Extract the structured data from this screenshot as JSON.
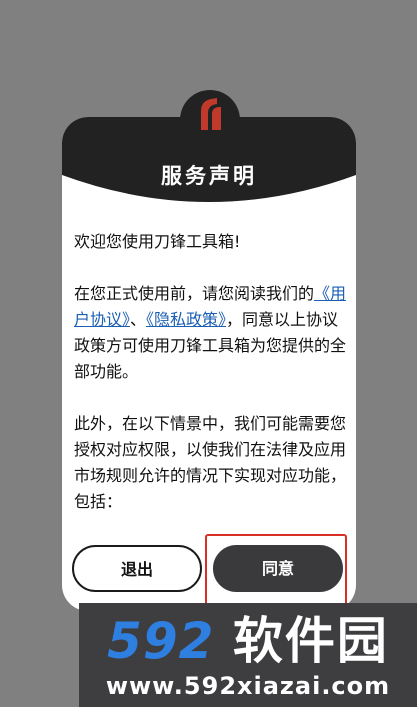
{
  "dialog": {
    "title": "服务声明",
    "greeting": "欢迎您使用刀锋工具箱!",
    "para1_before": "在您正式使用前，请您阅读我们的",
    "user_agreement_link": "《用户协议》",
    "separator": "、",
    "privacy_policy_link": "《隐私政策》",
    "para1_after": "，同意以上协议政策方可使用刀锋工具箱为您提供的全部功能。",
    "para2": " 此外，在以下情景中，我们可能需要您授权对应权限，以使我们在法律及应用市场规则允许的情况下实现对应功能，包括：",
    "exit_button": "退出",
    "agree_button": "同意"
  },
  "watermark": {
    "logo_number": "592",
    "logo_text": "软件园",
    "url": "www.592xiazai.com"
  },
  "colors": {
    "backdrop": "#808080",
    "header": "#222222",
    "link": "#1a5fb4",
    "agree_button": "#3a3a3d",
    "highlight": "#d93025",
    "logo_accent": "#c0392b",
    "watermark_blue": "#2f7fe0"
  },
  "icons": {
    "app_logo": "blade-logo-icon"
  }
}
